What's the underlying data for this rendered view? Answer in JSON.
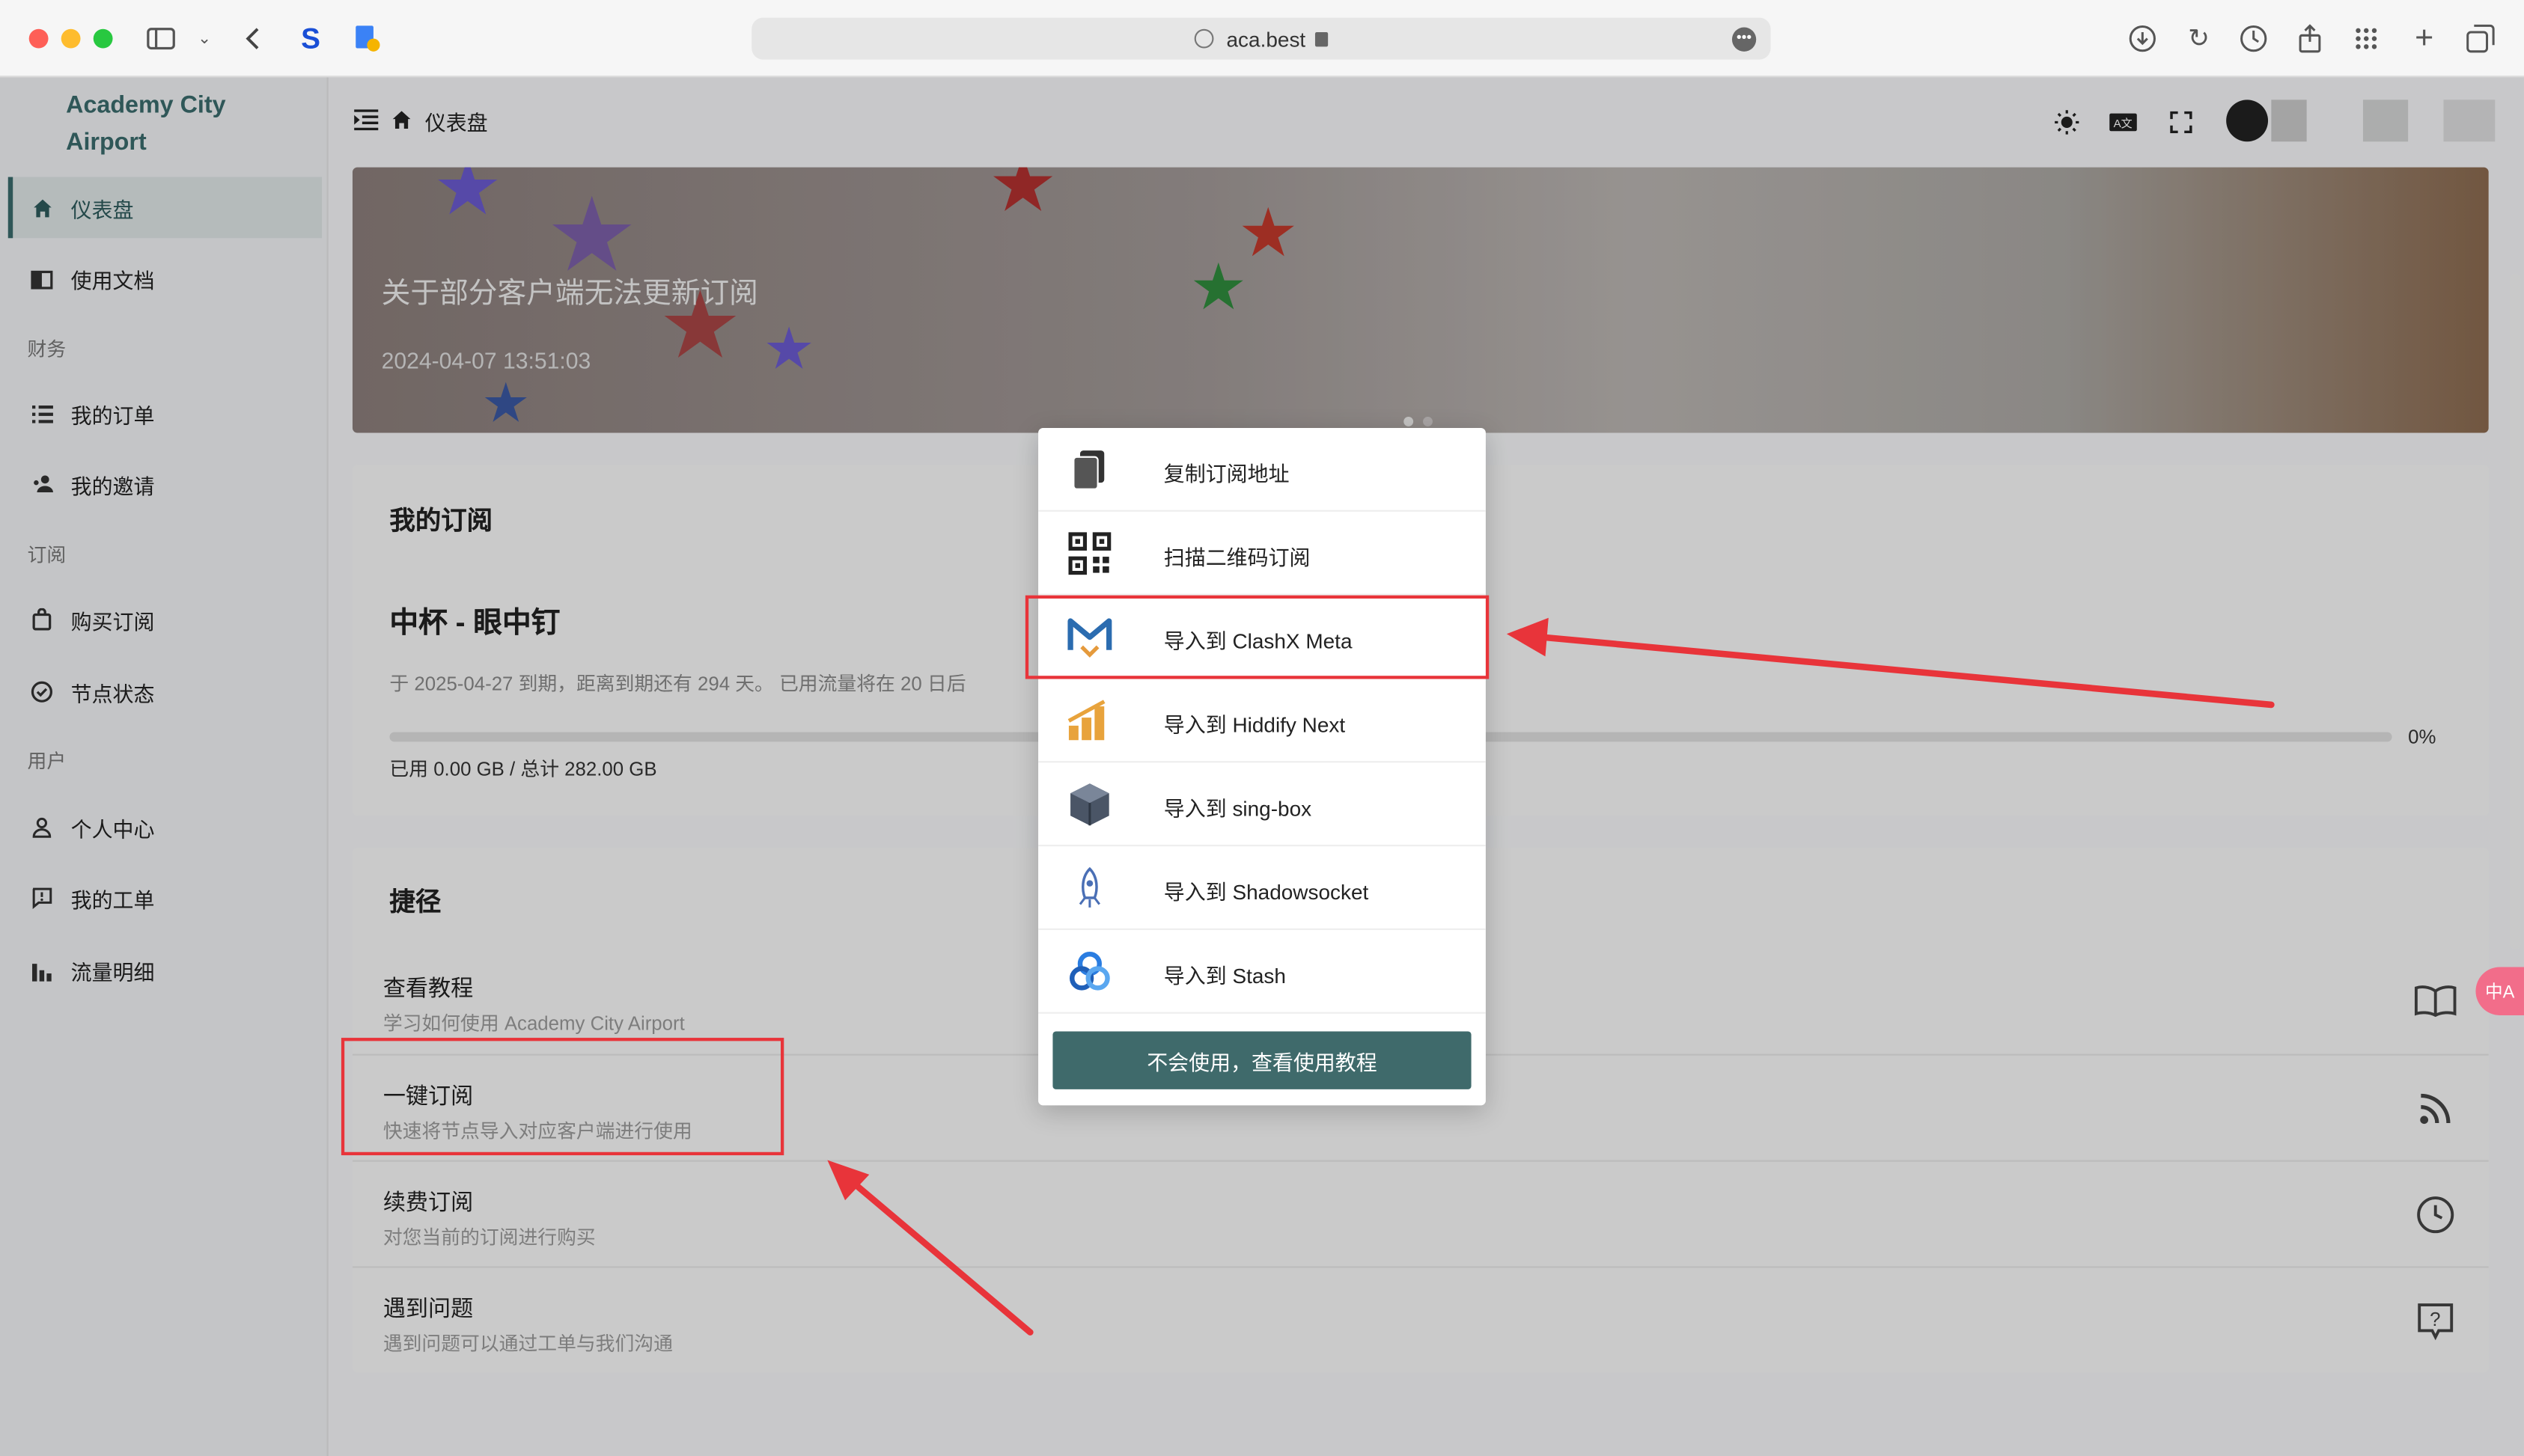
{
  "browser": {
    "url": "aca.best"
  },
  "sidebar": {
    "brand": "Academy City Airport",
    "items": [
      {
        "label": "仪表盘",
        "icon": "home-icon"
      },
      {
        "label": "使用文档",
        "icon": "book-icon"
      },
      {
        "section": "财务"
      },
      {
        "label": "我的订单",
        "icon": "list-icon"
      },
      {
        "label": "我的邀请",
        "icon": "users-icon"
      },
      {
        "section": "订阅"
      },
      {
        "label": "购买订阅",
        "icon": "bag-icon"
      },
      {
        "label": "节点状态",
        "icon": "check-circle-icon"
      },
      {
        "section": "用户"
      },
      {
        "label": "个人中心",
        "icon": "user-icon"
      },
      {
        "label": "我的工单",
        "icon": "ticket-icon"
      },
      {
        "label": "流量明细",
        "icon": "bar-chart-icon"
      }
    ]
  },
  "topbar": {
    "breadcrumb": "仪表盘"
  },
  "banner": {
    "title": "关于部分客户端无法更新订阅",
    "date": "2024-04-07 13:51:03"
  },
  "subscription": {
    "card_title": "我的订阅",
    "plan_name": "中杯 - 眼中钉",
    "description": "于 2025-04-27 到期，距离到期还有 294 天。 已用流量将在 20 日后",
    "progress_percent": 0,
    "progress_label": "0%",
    "usage": "已用 0.00 GB / 总计 282.00 GB"
  },
  "shortcuts": {
    "card_title": "捷径",
    "items": [
      {
        "title": "查看教程",
        "subtitle": "学习如何使用 Academy City Airport",
        "icon": "book-open-icon"
      },
      {
        "title": "一键订阅",
        "subtitle": "快速将节点导入对应客户端进行使用",
        "icon": "rss-icon"
      },
      {
        "title": "续费订阅",
        "subtitle": "对您当前的订阅进行购买",
        "icon": "clock-icon"
      },
      {
        "title": "遇到问题",
        "subtitle": "遇到问题可以通过工单与我们沟通",
        "icon": "help-message-icon"
      }
    ]
  },
  "popup": {
    "items": [
      {
        "label": "复制订阅地址",
        "icon": "copy-icon"
      },
      {
        "label": "扫描二维码订阅",
        "icon": "qrcode-icon"
      },
      {
        "label": "导入到 ClashX Meta",
        "icon": "clashx-meta-icon"
      },
      {
        "label": "导入到 Hiddify Next",
        "icon": "hiddify-icon"
      },
      {
        "label": "导入到 sing-box",
        "icon": "sing-box-icon"
      },
      {
        "label": "导入到 Shadowsocket",
        "icon": "shadowrocket-icon"
      },
      {
        "label": "导入到 Stash",
        "icon": "stash-icon"
      }
    ],
    "help_button": "不会使用，查看使用教程"
  },
  "colors": {
    "accent": "#3f6a6b",
    "annotation": "#e8343a"
  }
}
